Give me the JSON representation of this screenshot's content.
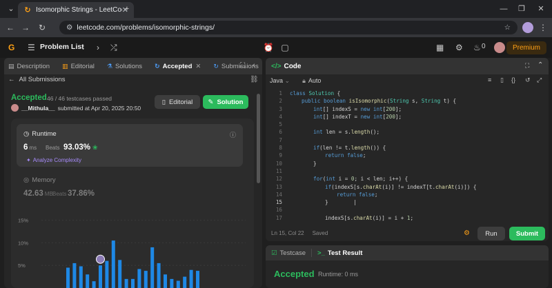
{
  "browser": {
    "tab_title": "Isomorphic Strings - LeetCode",
    "url": "leetcode.com/problems/isomorphic-strings/"
  },
  "nav": {
    "problem_list": "Problem List",
    "streak": "0",
    "premium": "Premium"
  },
  "left_tabs": [
    "Description",
    "Editorial",
    "Solutions",
    "Accepted",
    "Submissions"
  ],
  "submission": {
    "back": "All Submissions",
    "status": "Accepted",
    "passed": "46 / 46 testcases passed",
    "user": "__Mithula__",
    "submitted": "submitted at Apr 20, 2025 20:50",
    "editorial_btn": "Editorial",
    "solution_btn": "Solution"
  },
  "runtime": {
    "label": "Runtime",
    "value": "6",
    "unit": "ms",
    "beats_label": "Beats",
    "beats": "93.03%",
    "analyze": "Analyze Complexity"
  },
  "memory": {
    "label": "Memory",
    "value": "42.63",
    "unit": "MB",
    "beats_label": "Beats",
    "beats": "37.86%"
  },
  "chart_data": {
    "type": "bar",
    "ylim": [
      0,
      16
    ],
    "yticks": [
      "15%",
      "10%",
      "5%"
    ],
    "yticks_values": [
      15,
      10,
      5
    ],
    "values": [
      4.5,
      5.5,
      4.8,
      3.0,
      1.5,
      5.0,
      6.0,
      10.5,
      6.2,
      2.0,
      2.0,
      4.2,
      3.8,
      9.0,
      5.5,
      3.0,
      2.0,
      1.6,
      2.5,
      4.0,
      3.8
    ],
    "color": "#1e88e5",
    "highlight_index": 5
  },
  "code": {
    "title": "Code",
    "language": "Java",
    "mode": "Auto",
    "status_pos": "Ln 15, Col 22",
    "status_saved": "Saved",
    "run": "Run",
    "submit": "Submit",
    "current_line": 15,
    "lines": [
      {
        "n": 1,
        "indent": 0,
        "html": "<span class='kw'>class</span> <span class='ty'>Solution</span> {"
      },
      {
        "n": 2,
        "indent": 1,
        "html": "<span class='kw'>public boolean</span> <span class='fn'>isIsomorphic</span>(<span class='ty'>String</span> s, <span class='ty'>String</span> t) {"
      },
      {
        "n": 3,
        "indent": 2,
        "html": "<span class='kw'>int</span>[] indexS = <span class='kw'>new int</span>[<span class='nm'>200</span>];"
      },
      {
        "n": 4,
        "indent": 2,
        "html": "<span class='kw'>int</span>[] indexT = <span class='kw'>new int</span>[<span class='nm'>200</span>];"
      },
      {
        "n": 5,
        "indent": 0,
        "html": ""
      },
      {
        "n": 6,
        "indent": 2,
        "html": "<span class='kw'>int</span> len = s.<span class='fn'>length</span>();"
      },
      {
        "n": 7,
        "indent": 0,
        "html": ""
      },
      {
        "n": 8,
        "indent": 2,
        "html": "<span class='kw'>if</span>(len != t.<span class='fn'>length</span>()) {"
      },
      {
        "n": 9,
        "indent": 3,
        "html": "<span class='kw'>return false</span>;"
      },
      {
        "n": 10,
        "indent": 2,
        "html": "}"
      },
      {
        "n": 11,
        "indent": 0,
        "html": ""
      },
      {
        "n": 12,
        "indent": 2,
        "html": "<span class='kw'>for</span>(<span class='kw'>int</span> i = <span class='nm'>0</span>; i &lt; len; i++) {"
      },
      {
        "n": 13,
        "indent": 3,
        "html": "<span class='kw'>if</span>(indexS[s.<span class='fn'>charAt</span>(i)] != indexT[t.<span class='fn'>charAt</span>(i)]) {"
      },
      {
        "n": 14,
        "indent": 4,
        "html": "<span class='kw'>return false</span>;"
      },
      {
        "n": 15,
        "indent": 3,
        "html": "}        |"
      },
      {
        "n": 16,
        "indent": 0,
        "html": ""
      },
      {
        "n": 17,
        "indent": 3,
        "html": "indexS[s.<span class='fn'>charAt</span>(i)] = i + <span class='nm'>1</span>;"
      }
    ]
  },
  "test": {
    "tab1": "Testcase",
    "tab2": "Test Result",
    "result": "Accepted",
    "runtime": "Runtime: 0 ms"
  }
}
